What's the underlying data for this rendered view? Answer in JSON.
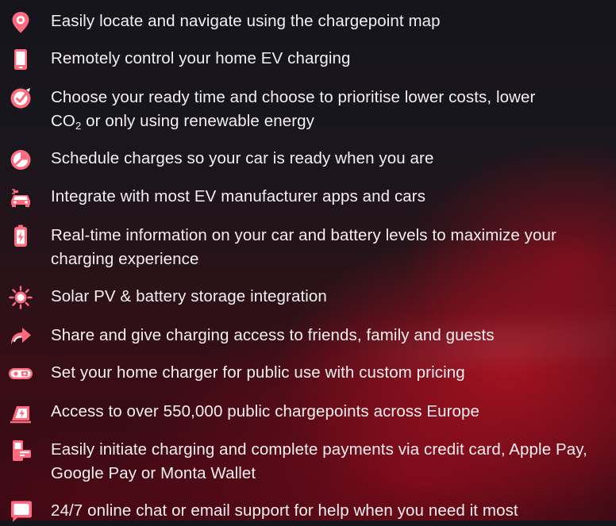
{
  "accent_color": "#ff6a7f",
  "features": [
    {
      "icon": "map-pin-icon",
      "text": "Easily locate and navigate using the chargepoint map"
    },
    {
      "icon": "phone-icon",
      "text": "Remotely control your home EV charging"
    },
    {
      "icon": "ready-time-gauge-icon",
      "text_before": "Choose your ready time and choose to prioritise lower costs, lower",
      "co2_prefix": "CO",
      "co2_sub": "2",
      "text_after": " or only using renewable energy"
    },
    {
      "icon": "schedule-clock-icon",
      "text": "Schedule charges so your car is ready when you are"
    },
    {
      "icon": "car-integration-icon",
      "text": "Integrate with most EV manufacturer apps and cars"
    },
    {
      "icon": "battery-icon",
      "text": "Real-time information on your car and battery levels to maximize your charging experience"
    },
    {
      "icon": "sun-icon",
      "text": "Solar PV & battery storage integration"
    },
    {
      "icon": "share-arrow-icon",
      "text": "Share and give charging access to friends, family and guests"
    },
    {
      "icon": "public-charger-toggle-icon",
      "text": "Set your home charger for public use with custom pricing"
    },
    {
      "icon": "public-chargepoints-icon",
      "text": "Access to over 550,000 public chargepoints across Europe"
    },
    {
      "icon": "payment-terminal-icon",
      "text": "Easily initiate charging and complete payments via credit card, Apple Pay, Google Pay or Monta Wallet"
    },
    {
      "icon": "chat-bubble-icon",
      "text": "24/7 online chat or email support for help when you need it most"
    }
  ]
}
